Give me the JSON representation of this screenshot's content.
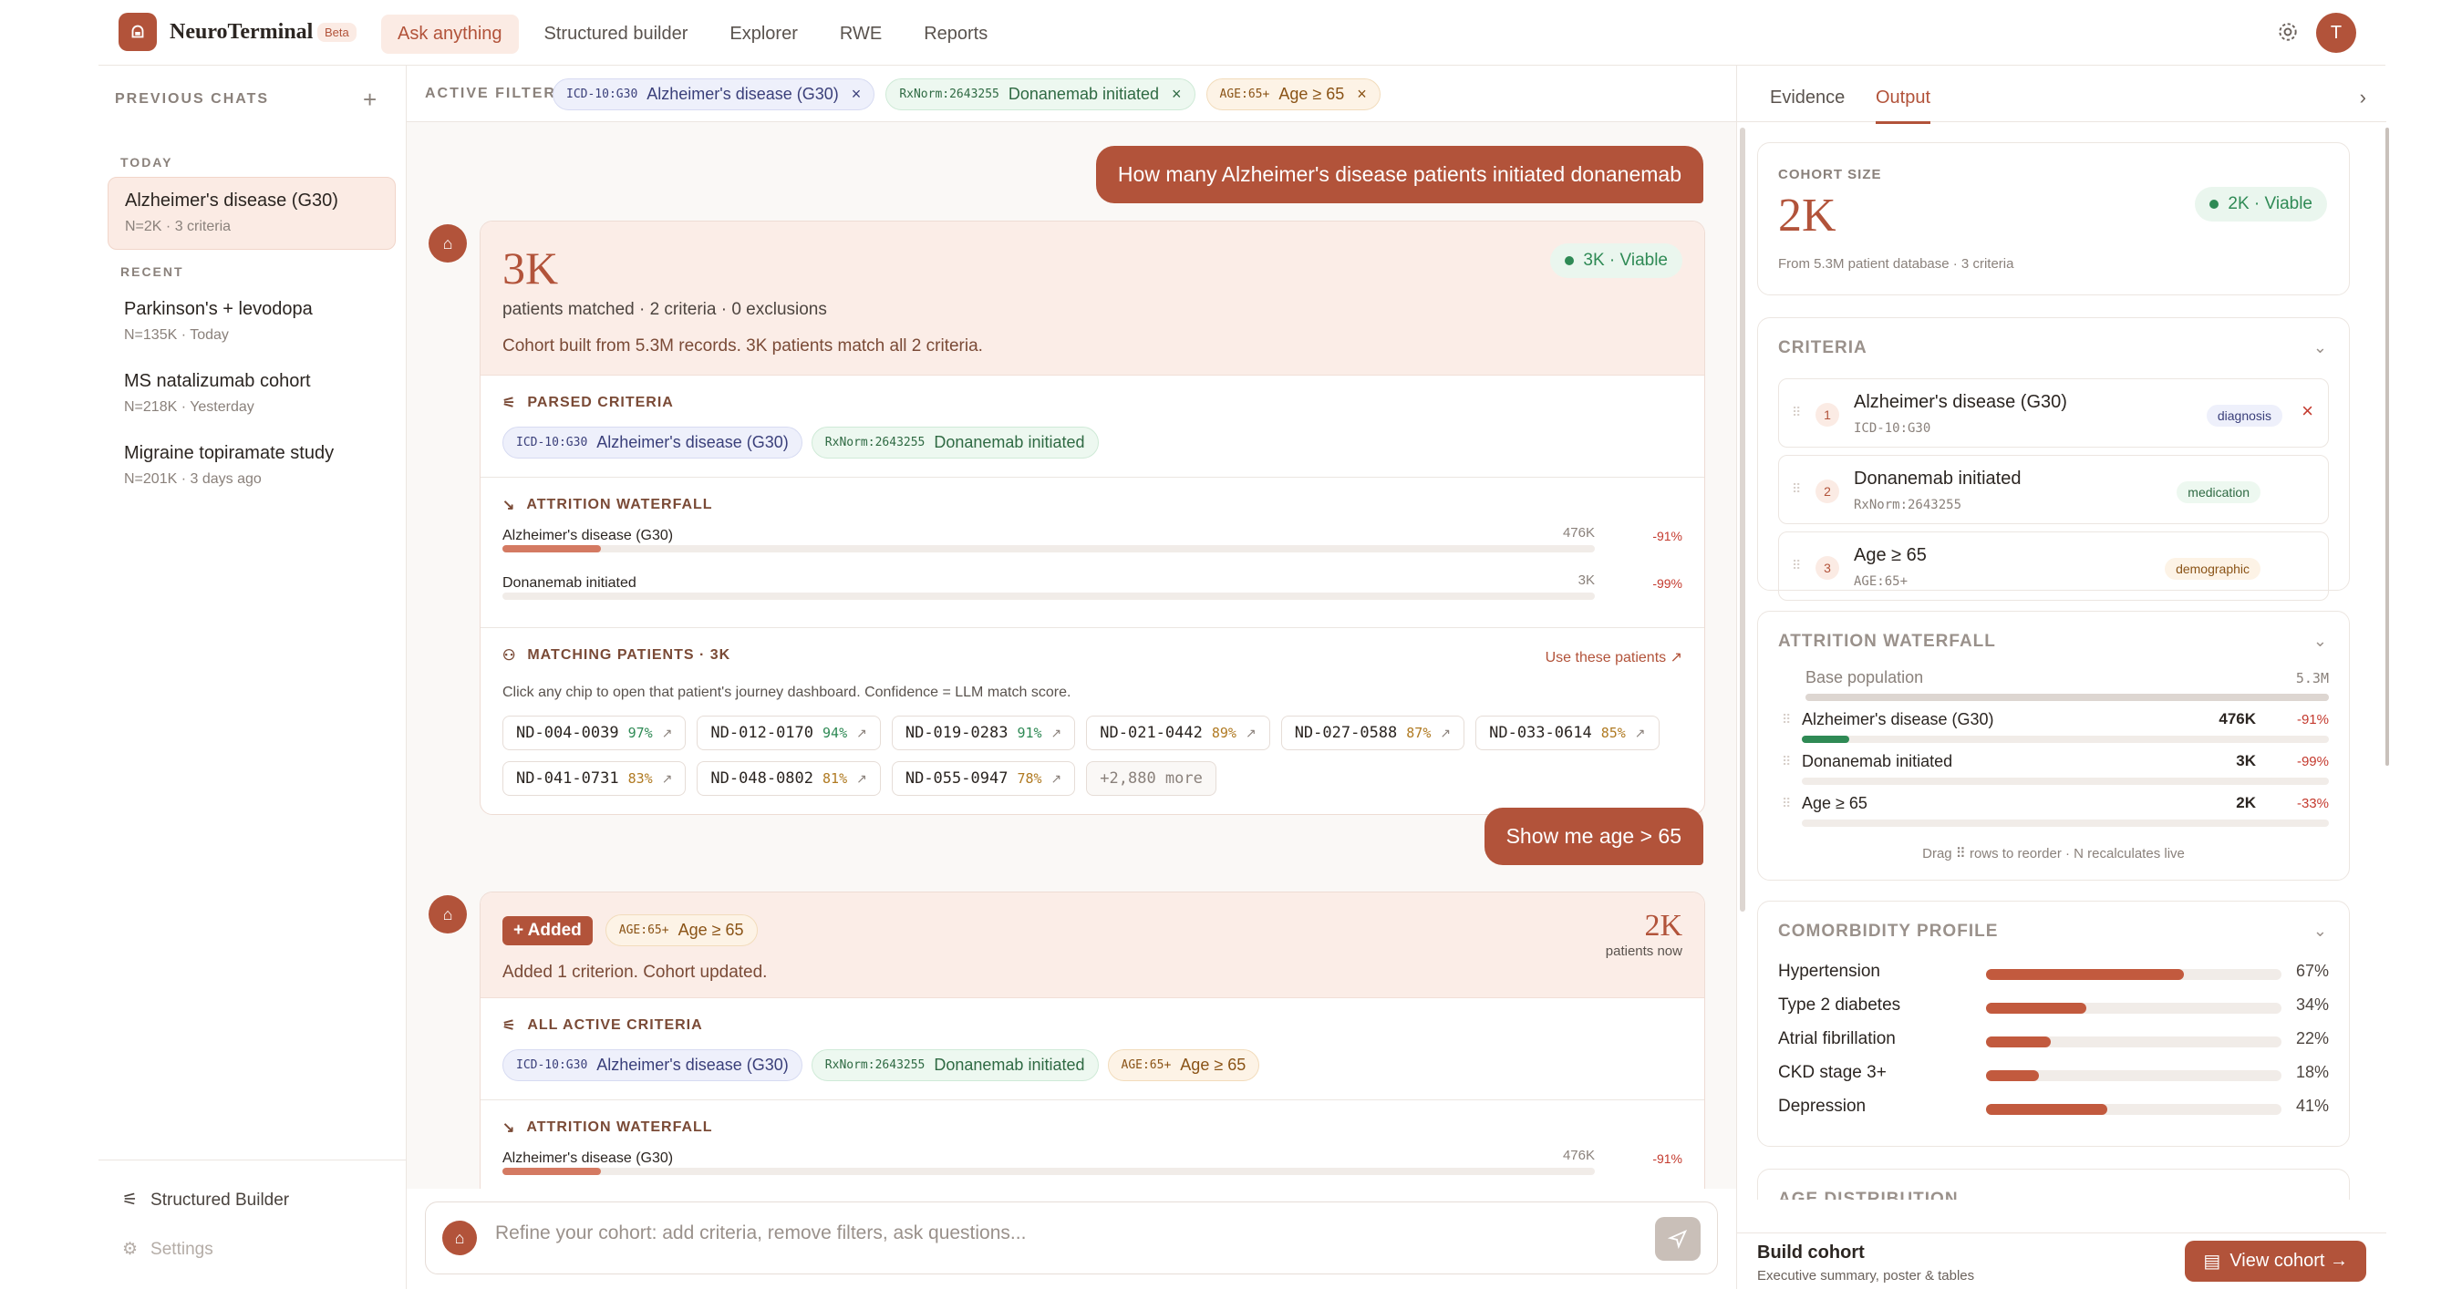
{
  "header": {
    "brand": "NeuroTerminal",
    "beta": "Beta",
    "nav": [
      "Ask anything",
      "Structured builder",
      "Explorer",
      "RWE",
      "Reports"
    ],
    "avatar": "T"
  },
  "sidebar": {
    "title": "PREVIOUS CHATS",
    "today_label": "TODAY",
    "recent_label": "RECENT",
    "today": [
      {
        "title": "Alzheimer's disease (G30)",
        "sub": "N=2K · 3 criteria"
      }
    ],
    "recent": [
      {
        "title": "Parkinson's + levodopa",
        "sub": "N=135K · Today"
      },
      {
        "title": "MS natalizumab cohort",
        "sub": "N=218K · Yesterday"
      },
      {
        "title": "Migraine topiramate study",
        "sub": "N=201K · 3 days ago"
      }
    ],
    "footer": {
      "builder": "Structured Builder",
      "settings": "Settings"
    }
  },
  "filters": {
    "label": "ACTIVE FILTERS",
    "chips": [
      {
        "code": "ICD-10:G30",
        "label": "Alzheimer's disease (G30)"
      },
      {
        "code": "RxNorm:2643255",
        "label": "Donanemab initiated"
      },
      {
        "code": "AGE:65+",
        "label": "Age ≥ 65"
      }
    ]
  },
  "chat": {
    "q1": "How many Alzheimer's disease patients initiated donanemab",
    "r1": {
      "count": "3K",
      "sub": "patients matched · 2 criteria · 0 exclusions",
      "desc": "Cohort built from 5.3M records. 3K patients match all 2 criteria.",
      "viable": "3K · Viable",
      "parsed_label": "PARSED CRITERIA",
      "attr_label": "ATTRITION WATERFALL",
      "waterfall": [
        {
          "name": "Alzheimer's disease (G30)",
          "count": "476K",
          "pct": "-91%",
          "frac": 0.09
        },
        {
          "name": "Donanemab initiated",
          "count": "3K",
          "pct": "-99%",
          "frac": 0.006
        }
      ],
      "match_label": "MATCHING PATIENTS · 3K",
      "use_label": "Use these patients ↗",
      "match_help": "Click any chip to open that patient's journey dashboard. Confidence = LLM match score.",
      "patients": [
        {
          "id": "ND-004-0039",
          "score": "97%"
        },
        {
          "id": "ND-012-0170",
          "score": "94%"
        },
        {
          "id": "ND-019-0283",
          "score": "91%"
        },
        {
          "id": "ND-021-0442",
          "score": "89%"
        },
        {
          "id": "ND-027-0588",
          "score": "87%"
        },
        {
          "id": "ND-033-0614",
          "score": "85%"
        },
        {
          "id": "ND-041-0731",
          "score": "83%"
        },
        {
          "id": "ND-048-0802",
          "score": "81%"
        },
        {
          "id": "ND-055-0947",
          "score": "78%"
        }
      ],
      "more": "+2,880 more"
    },
    "q2": "Show me age > 65",
    "r2": {
      "added": "+ Added",
      "count": "2K",
      "count_sub": "patients now",
      "desc": "Added 1 criterion. Cohort updated.",
      "all_label": "ALL ACTIVE CRITERIA",
      "attr_label": "ATTRITION WATERFALL",
      "wf1": {
        "name": "Alzheimer's disease (G30)",
        "count": "476K",
        "pct": "-91%",
        "frac": 0.09
      }
    }
  },
  "input": {
    "placeholder": "Refine your cohort: add criteria, remove filters, ask questions..."
  },
  "right": {
    "tabs": [
      "Evidence",
      "Output"
    ],
    "cohort": {
      "label": "COHORT SIZE",
      "value": "2K",
      "viable": "2K · Viable",
      "sub": "From 5.3M patient database · 3 criteria"
    },
    "criteria": {
      "label": "CRITERIA",
      "items": [
        {
          "n": "1",
          "name": "Alzheimer's disease (G30)",
          "code": "ICD-10:G30",
          "tag": "diagnosis"
        },
        {
          "n": "2",
          "name": "Donanemab initiated",
          "code": "RxNorm:2643255",
          "tag": "medication"
        },
        {
          "n": "3",
          "name": "Age ≥ 65",
          "code": "AGE:65+",
          "tag": "demographic"
        }
      ]
    },
    "attrition": {
      "label": "ATTRITION WATERFALL",
      "base": "Base population",
      "base_n": "5.3M",
      "rows": [
        {
          "name": "Alzheimer's disease (G30)",
          "count": "476K",
          "pct": "-91%",
          "frac": 0.09
        },
        {
          "name": "Donanemab initiated",
          "count": "3K",
          "pct": "-99%",
          "frac": 0.0006
        },
        {
          "name": "Age ≥ 65",
          "count": "2K",
          "pct": "-33%",
          "frac": 0.0004
        }
      ],
      "hint": "Drag ⠿ rows to reorder · N recalculates live"
    },
    "comorb": {
      "label": "COMORBIDITY PROFILE",
      "rows": [
        {
          "name": "Hypertension",
          "value": "67%",
          "frac": 0.67
        },
        {
          "name": "Type 2 diabetes",
          "value": "34%",
          "frac": 0.34
        },
        {
          "name": "Atrial fibrillation",
          "value": "22%",
          "frac": 0.22
        },
        {
          "name": "CKD stage 3+",
          "value": "18%",
          "frac": 0.18
        },
        {
          "name": "Depression",
          "value": "41%",
          "frac": 0.41
        }
      ]
    },
    "age": {
      "label": "AGE DISTRIBUTION"
    },
    "footer": {
      "title": "Build cohort",
      "sub": "Executive summary, poster & tables",
      "button": "View cohort →"
    }
  },
  "colors": {
    "accent": "#b2533a",
    "green": "#2f8a55"
  }
}
